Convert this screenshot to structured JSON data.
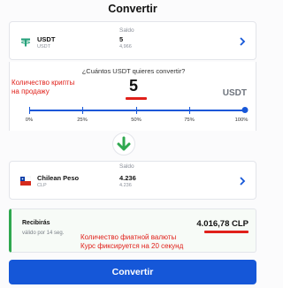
{
  "header": {
    "title": "Convertir"
  },
  "from": {
    "coin": "USDT",
    "coin_sub": "USDT",
    "saldo_label": "Saldo",
    "balance": "5",
    "balance_sub": "4,966",
    "icon": "tether-icon"
  },
  "amount": {
    "question": "¿Cuántos USDT quieres convertir?",
    "value": "5",
    "unit": "USDT",
    "annotation": "Количество крипты\nна продажу",
    "slider_value": 1.0,
    "ticks": [
      "0%",
      "25%",
      "50%",
      "75%",
      "100%"
    ]
  },
  "to": {
    "coin": "Chilean Peso",
    "coin_sub": "CLP",
    "saldo_label": "Saldo",
    "balance": "4.236",
    "balance_sub": "4.236",
    "icon": "chile-flag-icon"
  },
  "receive": {
    "label": "Recibirás",
    "value": "4.016,78 CLP",
    "valid": "válido por 14 seg.",
    "annotation": "Количество фиатной валюты\nКурс фиксируется на 20 секунд"
  },
  "button": {
    "label": "Convertir"
  },
  "colors": {
    "accent": "#1557d8",
    "annotation": "#e0201a",
    "green": "#2fa84f"
  }
}
